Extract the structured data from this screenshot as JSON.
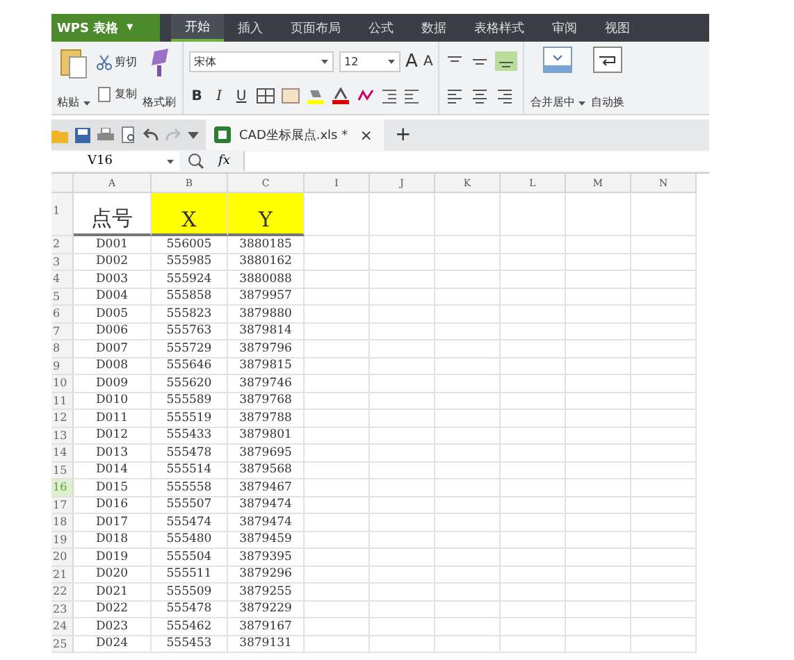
{
  "app_menu": {
    "label": "WPS 表格",
    "caret": "▾"
  },
  "ribbon_tabs": [
    {
      "label": "开始",
      "selected": true
    },
    {
      "label": "插入",
      "selected": false
    },
    {
      "label": "页面布局",
      "selected": false
    },
    {
      "label": "公式",
      "selected": false
    },
    {
      "label": "数据",
      "selected": false
    },
    {
      "label": "表格样式",
      "selected": false
    },
    {
      "label": "审阅",
      "selected": false
    },
    {
      "label": "视图",
      "selected": false
    }
  ],
  "ribbon": {
    "paste": "粘贴",
    "cut": "剪切",
    "copy": "复制",
    "format_painter": "格式刷",
    "font_name": "宋体",
    "font_size": "12",
    "grow_font": "A",
    "shrink_font": "A",
    "bold": "B",
    "italic": "I",
    "underline": "U",
    "merge": "合并居中",
    "wrap": "自动换"
  },
  "document_tab": {
    "title": "CAD坐标展点.xls *",
    "close": "×",
    "new_tab": "+"
  },
  "formula_bar": {
    "name_box": "V16",
    "fx": "fx"
  },
  "columns": [
    "A",
    "B",
    "C",
    "I",
    "J",
    "K",
    "L",
    "M",
    "N"
  ],
  "header_row": {
    "number": "1",
    "cells": [
      {
        "text": "点号",
        "highlighted": false
      },
      {
        "text": "X",
        "highlighted": true
      },
      {
        "text": "Y",
        "highlighted": true
      }
    ]
  },
  "rows": [
    {
      "number": "2",
      "selected": false,
      "cells": [
        "D001",
        "556005",
        "3880185"
      ]
    },
    {
      "number": "3",
      "selected": false,
      "cells": [
        "D002",
        "555985",
        "3880162"
      ]
    },
    {
      "number": "4",
      "selected": false,
      "cells": [
        "D003",
        "555924",
        "3880088"
      ]
    },
    {
      "number": "5",
      "selected": false,
      "cells": [
        "D004",
        "555858",
        "3879957"
      ]
    },
    {
      "number": "6",
      "selected": false,
      "cells": [
        "D005",
        "555823",
        "3879880"
      ]
    },
    {
      "number": "7",
      "selected": false,
      "cells": [
        "D006",
        "555763",
        "3879814"
      ]
    },
    {
      "number": "8",
      "selected": false,
      "cells": [
        "D007",
        "555729",
        "3879796"
      ]
    },
    {
      "number": "9",
      "selected": false,
      "cells": [
        "D008",
        "555646",
        "3879815"
      ]
    },
    {
      "number": "10",
      "selected": false,
      "cells": [
        "D009",
        "555620",
        "3879746"
      ]
    },
    {
      "number": "11",
      "selected": false,
      "cells": [
        "D010",
        "555589",
        "3879768"
      ]
    },
    {
      "number": "12",
      "selected": false,
      "cells": [
        "D011",
        "555519",
        "3879788"
      ]
    },
    {
      "number": "13",
      "selected": false,
      "cells": [
        "D012",
        "555433",
        "3879801"
      ]
    },
    {
      "number": "14",
      "selected": false,
      "cells": [
        "D013",
        "555478",
        "3879695"
      ]
    },
    {
      "number": "15",
      "selected": false,
      "cells": [
        "D014",
        "555514",
        "3879568"
      ]
    },
    {
      "number": "16",
      "selected": true,
      "cells": [
        "D015",
        "555558",
        "3879467"
      ]
    },
    {
      "number": "17",
      "selected": false,
      "cells": [
        "D016",
        "555507",
        "3879474"
      ]
    },
    {
      "number": "18",
      "selected": false,
      "cells": [
        "D017",
        "555474",
        "3879474"
      ]
    },
    {
      "number": "19",
      "selected": false,
      "cells": [
        "D018",
        "555480",
        "3879459"
      ]
    },
    {
      "number": "20",
      "selected": false,
      "cells": [
        "D019",
        "555504",
        "3879395"
      ]
    },
    {
      "number": "21",
      "selected": false,
      "cells": [
        "D020",
        "555511",
        "3879296"
      ]
    },
    {
      "number": "22",
      "selected": false,
      "cells": [
        "D021",
        "555509",
        "3879255"
      ]
    },
    {
      "number": "23",
      "selected": false,
      "cells": [
        "D022",
        "555478",
        "3879229"
      ]
    },
    {
      "number": "24",
      "selected": false,
      "cells": [
        "D023",
        "555462",
        "3879167"
      ]
    },
    {
      "number": "25",
      "selected": false,
      "cells": [
        "D024",
        "555453",
        "3879131"
      ]
    }
  ]
}
